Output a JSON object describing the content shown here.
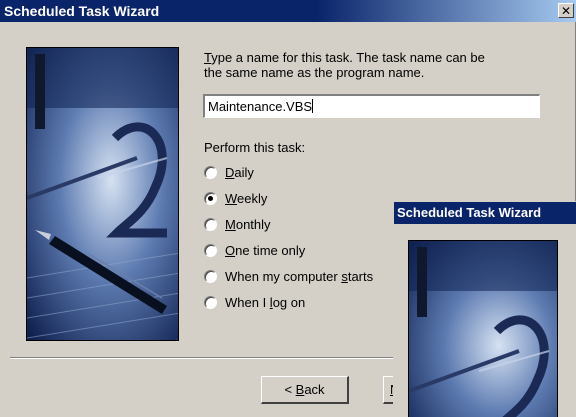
{
  "window": {
    "title": "Scheduled Task Wizard",
    "close_glyph": "✕"
  },
  "prompt": {
    "line1_accel": "T",
    "line1_rest": "ype a name for this task.  The task name can be",
    "line2": "the same name as the program name."
  },
  "name_input": {
    "value": "Maintenance.VBS"
  },
  "perform": {
    "label": "Perform this task:",
    "options": [
      {
        "accel": "D",
        "rest": "aily",
        "checked": false
      },
      {
        "accel": "W",
        "rest": "eekly",
        "checked": true
      },
      {
        "accel": "M",
        "rest": "onthly",
        "checked": false
      },
      {
        "accel": "O",
        "rest": "ne time only",
        "checked": false
      },
      {
        "pre": "When my computer ",
        "accel": "s",
        "rest": "tarts",
        "checked": false
      },
      {
        "pre": "When I ",
        "accel": "l",
        "rest": "og on",
        "checked": false
      }
    ]
  },
  "buttons": {
    "back_pre": "< ",
    "back_accel": "B",
    "back_rest": "ack",
    "next_partial": "N"
  },
  "second_window": {
    "title": "Scheduled Task Wizard"
  },
  "icons": [
    "close-icon",
    "radio-selected",
    "radio-unselected"
  ],
  "colors": {
    "titlebar": "#0a246a",
    "face": "#d4d0c8"
  }
}
